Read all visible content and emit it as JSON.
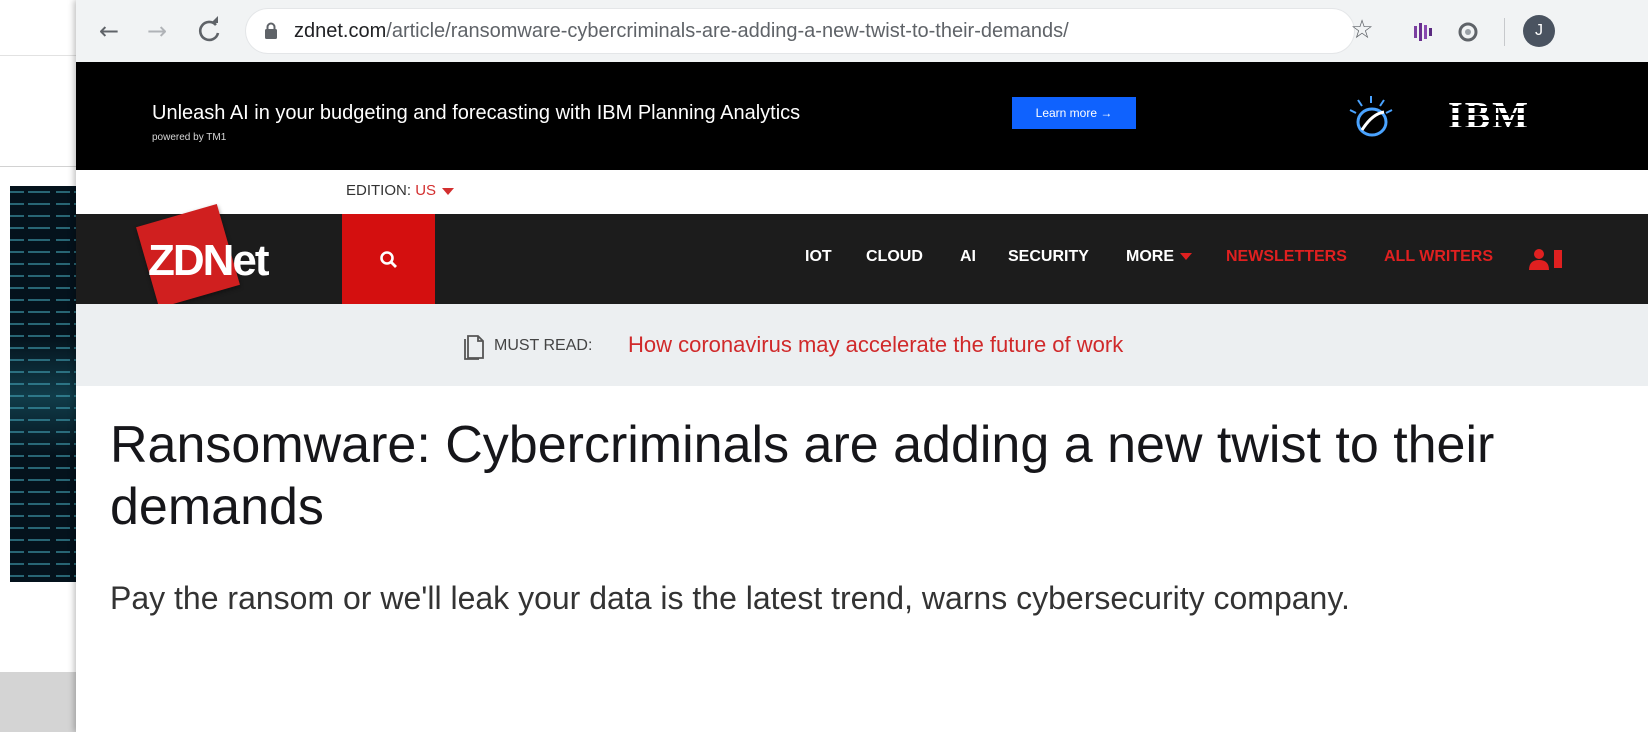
{
  "browser": {
    "url_domain": "zdnet.com",
    "url_path": "/article/ransomware-cybercriminals-are-adding-a-new-twist-to-their-demands/",
    "avatar_initial": "J"
  },
  "ad": {
    "headline": "Unleash AI in your budgeting and forecasting with IBM Planning Analytics",
    "subline": "powered by TM1",
    "cta_label": "Learn more",
    "brand_logo_text": "IBM",
    "cta_color": "#0f62fe"
  },
  "edition": {
    "label": "EDITION:",
    "value": "US"
  },
  "nav": {
    "logo_text": "ZDNet",
    "items": [
      {
        "label": "IOT"
      },
      {
        "label": "CLOUD"
      },
      {
        "label": "AI"
      },
      {
        "label": "SECURITY"
      },
      {
        "label": "MORE"
      },
      {
        "label": "NEWSLETTERS"
      },
      {
        "label": "ALL WRITERS"
      }
    ],
    "accent_color": "#d40f0f"
  },
  "must_read": {
    "label": "MUST READ:",
    "link": "How coronavirus may accelerate the future of work"
  },
  "article": {
    "title": "Ransomware: Cybercriminals are adding a new twist to their demands",
    "subtitle": "Pay the ransom or we'll leak your data is the latest trend, warns cybersecurity company."
  },
  "icons": {
    "back": "arrow-left-icon",
    "forward": "arrow-right-icon",
    "reload": "reload-icon",
    "lock": "lock-icon",
    "bookmark": "star-icon",
    "search": "search-icon",
    "user": "user-icon",
    "document": "document-icon"
  }
}
